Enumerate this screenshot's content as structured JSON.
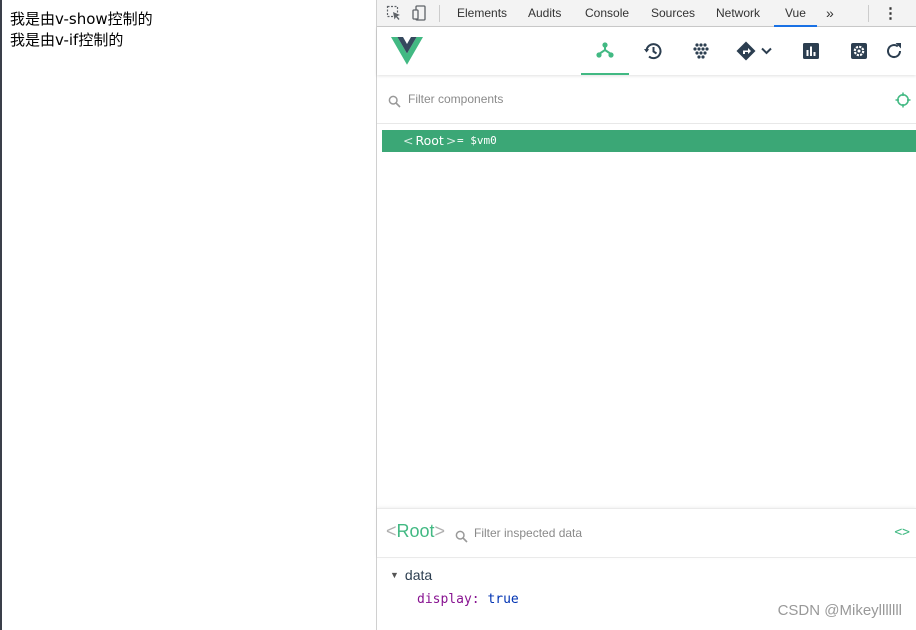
{
  "page": {
    "lines": [
      "我是由v-show控制的",
      "我是由v-if控制的"
    ]
  },
  "devtools": {
    "tabs": [
      "Elements",
      "Audits",
      "Console",
      "Sources",
      "Network",
      "Vue"
    ],
    "active_tab": "Vue",
    "more_tabs_glyph": "»",
    "menu_glyph": "⋮"
  },
  "vue": {
    "toolbar_icons": [
      "components-icon",
      "history-icon",
      "vuex-icon",
      "routing-icon",
      "performance-icon",
      "settings-icon",
      "refresh-icon"
    ],
    "accent_color": "#42b983",
    "filter_components_placeholder": "Filter components",
    "tree": {
      "root_open": "<",
      "root_name": "Root",
      "root_close": ">",
      "root_ref": "= $vm0"
    },
    "inspector": {
      "open_bracket": "<",
      "title": "Root",
      "close_bracket": ">",
      "filter_placeholder": "Filter inspected data",
      "code_glyph": "<>",
      "section": "data",
      "prop_key": "display",
      "prop_sep": ":",
      "prop_value": "true"
    }
  },
  "watermark": "CSDN @Mikeylllllll"
}
